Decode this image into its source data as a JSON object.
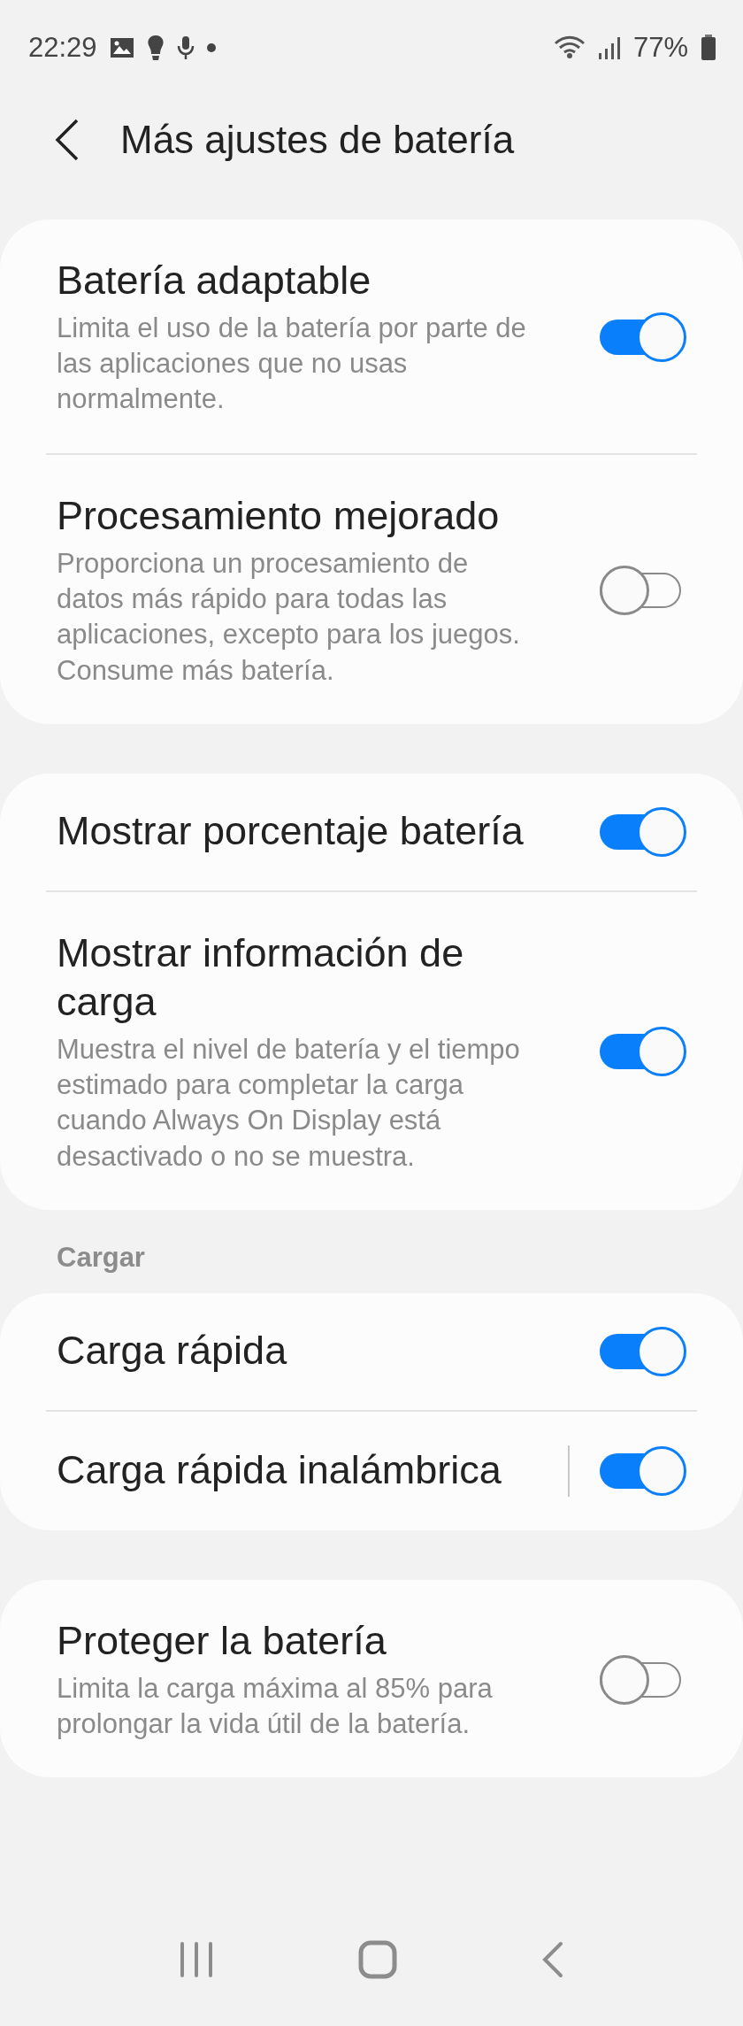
{
  "status_bar": {
    "time": "22:29",
    "battery": "77%"
  },
  "header": {
    "title": "Más ajustes de batería"
  },
  "groups": [
    {
      "items": [
        {
          "title": "Batería adaptable",
          "description": "Limita el uso de la batería por parte de las aplicaciones que no usas normalmente.",
          "on": true
        },
        {
          "title": "Procesamiento mejorado",
          "description": "Proporciona un procesamiento de datos más rápido para todas las aplicaciones, excepto para los juegos. Consume más batería.",
          "on": false
        }
      ]
    },
    {
      "items": [
        {
          "title": "Mostrar porcentaje batería",
          "on": true
        },
        {
          "title": "Mostrar información de carga",
          "description": "Muestra el nivel de batería y el tiempo estimado para completar la carga cuando Always On Display está desactivado o no se muestra.",
          "on": true
        }
      ]
    },
    {
      "label": "Cargar",
      "items": [
        {
          "title": "Carga rápida",
          "on": true
        },
        {
          "title": "Carga rápida inalámbrica",
          "on": true,
          "separator": true
        }
      ]
    },
    {
      "items": [
        {
          "title": "Proteger la batería",
          "description": "Limita la carga máxima al 85% para prolongar la vida útil de la batería.",
          "on": false
        }
      ]
    }
  ]
}
